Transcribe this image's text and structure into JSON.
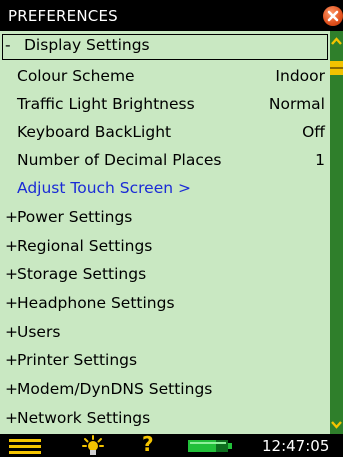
{
  "window": {
    "title": "PREFERENCES"
  },
  "section": {
    "marker": "-",
    "label": "Display Settings"
  },
  "settings": [
    {
      "label": "Colour Scheme",
      "value": "Indoor"
    },
    {
      "label": "Traffic Light Brightness",
      "value": "Normal"
    },
    {
      "label": "Keyboard BackLight",
      "value": "Off"
    },
    {
      "label": "Number of Decimal Places",
      "value": "1"
    }
  ],
  "link": {
    "label": "Adjust Touch Screen >"
  },
  "groups": [
    {
      "marker": "+",
      "label": "Power Settings"
    },
    {
      "marker": "+",
      "label": "Regional Settings"
    },
    {
      "marker": "+",
      "label": "Storage Settings"
    },
    {
      "marker": "+",
      "label": "Headphone Settings"
    },
    {
      "marker": "+",
      "label": "Users"
    },
    {
      "marker": "+",
      "label": "Printer Settings"
    },
    {
      "marker": "+",
      "label": "Modem/DynDNS Settings"
    },
    {
      "marker": "+",
      "label": "Network Settings"
    }
  ],
  "statusbar": {
    "time": "12:47:05",
    "help": "?"
  },
  "icons": {
    "close": "close-icon",
    "menu": "menu-icon",
    "backlight": "bulb-icon",
    "help": "help-icon",
    "battery": "battery-icon",
    "scroll_up": "chevron-up-icon",
    "scroll_down": "chevron-down-icon"
  },
  "colors": {
    "background": "#c9e8c2",
    "bar": "#000000",
    "link": "#1a2bd6",
    "accent": "#f4c400",
    "scrollbar": "#2f7f2b",
    "battery": "#22c03a"
  }
}
